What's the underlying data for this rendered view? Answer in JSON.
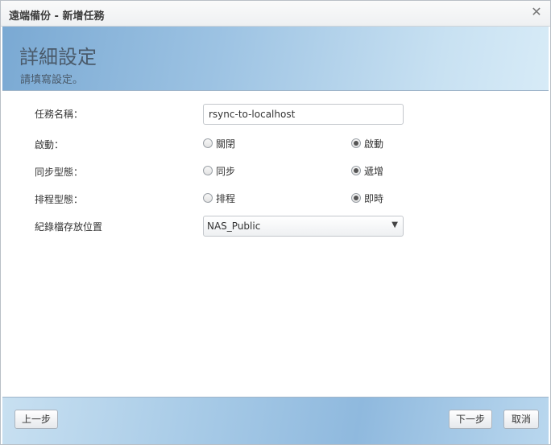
{
  "window": {
    "title": "遠端備份 - 新增任務",
    "close_glyph": "✕"
  },
  "banner": {
    "heading": "詳細設定",
    "subheading": "請填寫設定。"
  },
  "form": {
    "task_name": {
      "label": "任務名稱：",
      "value": "rsync-to-localhost"
    },
    "enable": {
      "label": "啟動：",
      "options": [
        "關閉",
        "啟動"
      ],
      "selected": "啟動"
    },
    "sync_type": {
      "label": "同步型態：",
      "options": [
        "同步",
        "遞增"
      ],
      "selected": "遞增"
    },
    "schedule_type": {
      "label": "排程型態：",
      "options": [
        "排程",
        "即時"
      ],
      "selected": "即時"
    },
    "log_location": {
      "label": "紀錄檔存放位置",
      "value": "NAS_Public",
      "arrow_glyph": "▼"
    }
  },
  "footer": {
    "prev_label": "上一步",
    "next_label": "下一步",
    "cancel_label": "取消"
  }
}
